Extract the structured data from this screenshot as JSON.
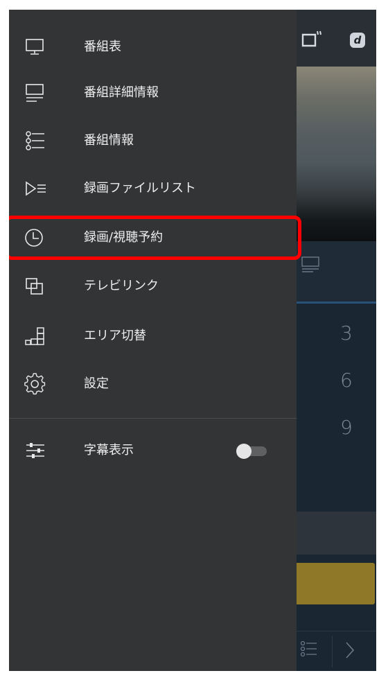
{
  "background_app": {
    "header_icons": [
      "tv-icon",
      "d-logo-icon"
    ],
    "d_logo_text": "d",
    "number_pad": [
      "3",
      "6",
      "9"
    ],
    "bottom_icons": [
      "list-icon",
      "chevron-right-icon"
    ]
  },
  "drawer": {
    "items": [
      {
        "label": "番組表",
        "icon": "monitor-icon"
      },
      {
        "label": "番組詳細情報",
        "icon": "monitor-detail-icon"
      },
      {
        "label": "番組情報",
        "icon": "list-bullets-icon"
      },
      {
        "label": "録画ファイルリスト",
        "icon": "play-list-icon"
      },
      {
        "label": "録画/視聴予約",
        "icon": "clock-icon",
        "highlighted": true
      },
      {
        "label": "テレビリンク",
        "icon": "overlap-squares-icon"
      },
      {
        "label": "エリア切替",
        "icon": "area-blocks-icon"
      },
      {
        "label": "設定",
        "icon": "gear-icon"
      }
    ],
    "subtitle_item": {
      "label": "字幕表示",
      "icon": "sliders-icon",
      "toggle_on": false
    }
  },
  "colors": {
    "highlight": "#ff0000",
    "drawer_bg": "#333436",
    "toggle_off": "#5e6062"
  }
}
